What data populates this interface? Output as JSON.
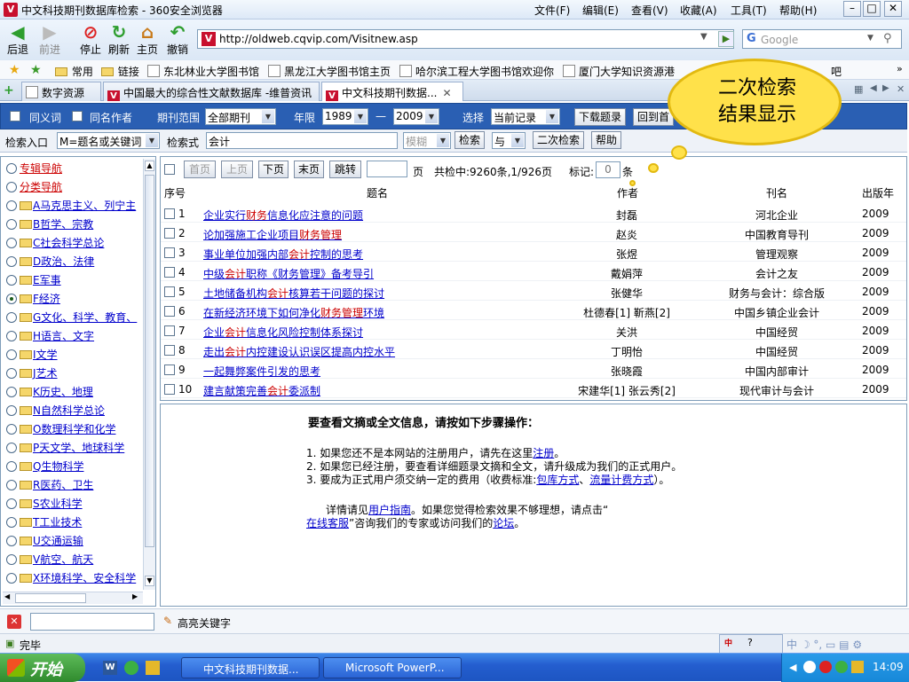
{
  "window": {
    "title": "中文科技期刊数据库检索 - 360安全浏览器",
    "menu": [
      "文件(F)",
      "编辑(E)",
      "查看(V)",
      "收藏(A)",
      "工具(T)",
      "帮助(H)"
    ]
  },
  "toolbar": {
    "back": "后退",
    "forward": "前进",
    "stop": "停止",
    "refresh": "刷新",
    "home": "主页",
    "undo": "撤销",
    "address": "http://oldweb.cqvip.com/Visitnew.asp",
    "search_placeholder": "Google"
  },
  "bookmarks": [
    "常用",
    "链接",
    "东北林业大学图书馆",
    "黑龙江大学图书馆主页",
    "哈尔滨工程大学图书馆欢迎你",
    "厦门大学知识资源港"
  ],
  "bookmarks_partial": "吧",
  "tabs": [
    "数字资源",
    "中国最大的综合性文献数据库 -维普资讯",
    "中文科技期刊数据..."
  ],
  "callout": {
    "line1": "二次检索",
    "line2": "结果显示"
  },
  "search_bar": {
    "synonym": "同义词",
    "same_author": "同名作者",
    "period_label": "期刊范围",
    "period_value": "全部期刊",
    "year_label": "年限",
    "year_from": "1989",
    "year_sep": "—",
    "year_to": "2009",
    "choose_label": "选择",
    "choose_value": "当前记录",
    "download": "下载题录",
    "back_home": "回到首",
    "entry_label": "检索入口",
    "entry_value": "M=题名或关键词",
    "query_label": "检索式",
    "query_value": "会计",
    "match_value": "模糊",
    "search_btn": "检索",
    "logic_value": "与",
    "second_search": "二次检索",
    "help": "帮助"
  },
  "left_nav": [
    {
      "label": "专辑导航",
      "type": "red",
      "radio": false
    },
    {
      "label": "分类导航",
      "type": "red",
      "radio": false
    },
    {
      "label": "A马克思主义、列宁主",
      "type": "link",
      "radio": false
    },
    {
      "label": "B哲学、宗教",
      "type": "link",
      "radio": false
    },
    {
      "label": "C社会科学总论",
      "type": "link",
      "radio": false
    },
    {
      "label": "D政治、法律",
      "type": "link",
      "radio": false
    },
    {
      "label": "E军事",
      "type": "link",
      "radio": false
    },
    {
      "label": "F经济",
      "type": "link",
      "radio": true
    },
    {
      "label": "G文化、科学、教育、",
      "type": "link",
      "radio": false
    },
    {
      "label": "H语言、文字",
      "type": "link",
      "radio": false
    },
    {
      "label": "I文学",
      "type": "link",
      "radio": false
    },
    {
      "label": "J艺术",
      "type": "link",
      "radio": false
    },
    {
      "label": "K历史、地理",
      "type": "link",
      "radio": false
    },
    {
      "label": "N自然科学总论",
      "type": "link",
      "radio": false
    },
    {
      "label": "O数理科学和化学",
      "type": "link",
      "radio": false
    },
    {
      "label": "P天文学、地球科学",
      "type": "link",
      "radio": false
    },
    {
      "label": "Q生物科学",
      "type": "link",
      "radio": false
    },
    {
      "label": "R医药、卫生",
      "type": "link",
      "radio": false
    },
    {
      "label": "S农业科学",
      "type": "link",
      "radio": false
    },
    {
      "label": "T工业技术",
      "type": "link",
      "radio": false
    },
    {
      "label": "U交通运输",
      "type": "link",
      "radio": false
    },
    {
      "label": "V航空、航天",
      "type": "link",
      "radio": false
    },
    {
      "label": "X环境科学、安全科学",
      "type": "link",
      "radio": false
    }
  ],
  "results": {
    "first": "首页",
    "prev": "上页",
    "next": "下页",
    "last": "末页",
    "jump": "跳转",
    "page_unit": "页",
    "summary": "共检中:9260条,1/926页",
    "mark_label": "标记:",
    "mark_value": "0",
    "mark_unit": "条",
    "headers": {
      "no": "序号",
      "title": "题名",
      "author": "作者",
      "journal": "刊名",
      "year": "出版年"
    },
    "rows": [
      {
        "no": "1",
        "title": [
          "企业实行",
          "财务",
          "信息化应注意的问题"
        ],
        "author": "封磊",
        "journal": "河北企业",
        "year": "2009"
      },
      {
        "no": "2",
        "title": [
          "论加强施工企业项目",
          "财务管理",
          ""
        ],
        "author": "赵炎",
        "journal": "中国教育导刊",
        "year": "2009"
      },
      {
        "no": "3",
        "title": [
          "事业单位加强内部",
          "会计",
          "控制的思考"
        ],
        "author": "张煜",
        "journal": "管理观察",
        "year": "2009"
      },
      {
        "no": "4",
        "title": [
          "中级",
          "会计",
          "职称《财务管理》备考导引"
        ],
        "author": "戴娟萍",
        "journal": "会计之友",
        "year": "2009"
      },
      {
        "no": "5",
        "title": [
          "土地储备机构",
          "会计",
          "核算若干问题的探讨"
        ],
        "author": "张健华",
        "journal": "财务与会计：综合版",
        "year": "2009"
      },
      {
        "no": "6",
        "title": [
          "在新经济环境下如何净化",
          "财务管理",
          "环境"
        ],
        "author": "杜德春[1] 靳燕[2]",
        "journal": "中国乡镇企业会计",
        "year": "2009"
      },
      {
        "no": "7",
        "title": [
          "企业",
          "会计",
          "信息化风险控制体系探讨"
        ],
        "author": "关洪",
        "journal": "中国经贸",
        "year": "2009"
      },
      {
        "no": "8",
        "title": [
          "走出",
          "会计",
          "内控建设认识误区提高内控水平"
        ],
        "author": "丁明怡",
        "journal": "中国经贸",
        "year": "2009"
      },
      {
        "no": "9",
        "title": [
          "一起舞弊案件引发的思考",
          "",
          ""
        ],
        "author": "张晓霞",
        "journal": "中国内部审计",
        "year": "2009"
      },
      {
        "no": "10",
        "title": [
          "建言献策完善",
          "会计",
          "委派制"
        ],
        "author": "宋建华[1] 张云秀[2]",
        "journal": "现代审计与会计",
        "year": "2009"
      }
    ]
  },
  "info": {
    "heading": "要查看文摘或全文信息，请按如下步骤操作：",
    "step1_pre": "1. 如果您还不是本网站的注册用户，请先在这里",
    "step1_link": "注册",
    "step1_post": "。",
    "step2": "2. 如果您已经注册，要查看详细题录文摘和全文，请升级成为我们的正式用户。",
    "step3_pre": "3. 要成为正式用户须交纳一定的费用（收费标准:",
    "step3_link1": "包库方式",
    "step3_sep": "、",
    "step3_link2": "流量计费方式",
    "step3_post": "）。",
    "para_pre": "详情请见",
    "para_link1": "用户指南",
    "para_mid": "。如果您觉得检索效果不够理想，请点击“",
    "para_link2": "在线客服",
    "para_mid2": "”咨询我们的专家或访问我们的",
    "para_link3": "论坛",
    "para_post": "。"
  },
  "findbar": {
    "highlight": "高亮关键字"
  },
  "status": {
    "text": "完毕"
  },
  "taskbar": {
    "start": "开始",
    "tasks": [
      "中文科技期刊数据...",
      "Microsoft PowerP..."
    ],
    "clock": "14:09"
  }
}
